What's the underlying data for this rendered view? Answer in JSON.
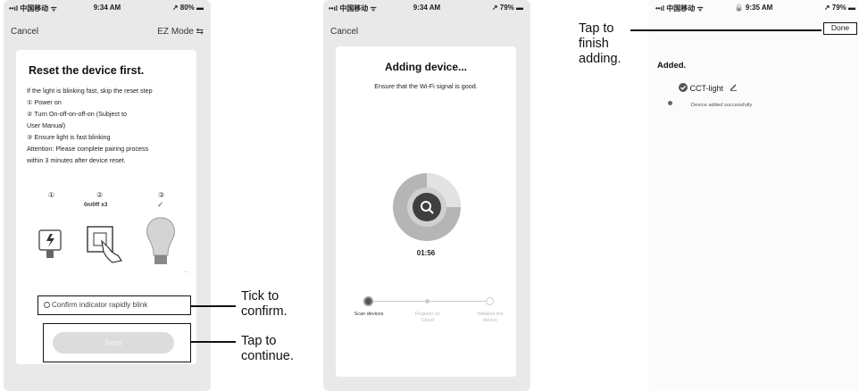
{
  "screen1": {
    "status": {
      "signal": "••ıl 中国移动 ᯤ",
      "time": "9:34 AM",
      "battery": "↗ 80% ▬"
    },
    "cancel": "Cancel",
    "mode": "EZ Mode ⇆",
    "title": "Reset the device first.",
    "lines": [
      "If the light is blinking fast, skip the reset step",
      "① Power on",
      "② Turn On-off-on-off-on (Subject to",
      "User Manual)",
      "③ Ensure light is fast blinking",
      "Attention: Please complete pairing process",
      "within 3 minutes after device reset."
    ],
    "steps": [
      "①",
      "②",
      "③"
    ],
    "onoff": "0n/0ff x3",
    "check": "✓",
    "confirm_label": "Confirm indicator rapidly blink",
    "next_label": "Next"
  },
  "screen2": {
    "status": {
      "signal": "••ıl 中国移动 ᯤ",
      "time": "9:34 AM",
      "battery": "↗ 79% ▬"
    },
    "cancel": "Cancel",
    "title": "Adding device...",
    "subtitle": "Ensure that the Wi-Fi signal is good.",
    "timer": "01:56",
    "stages": [
      "Scan devices",
      "Register on Cloud",
      "Initialize the device"
    ]
  },
  "screen3": {
    "status": {
      "signal": "••ıl 中国移动 ᯤ",
      "time": "🔒 9:35 AM",
      "battery": "↗ 79% ▬"
    },
    "done": "Done",
    "added": "Added.",
    "device_name": "CCT-light",
    "device_status": "Device added successfully"
  },
  "callouts": {
    "tick": [
      "Tick to",
      "confirm."
    ],
    "tap_continue": [
      "Tap to",
      "continue."
    ],
    "tap_finish": [
      "Tap to",
      "finish",
      "adding."
    ]
  }
}
